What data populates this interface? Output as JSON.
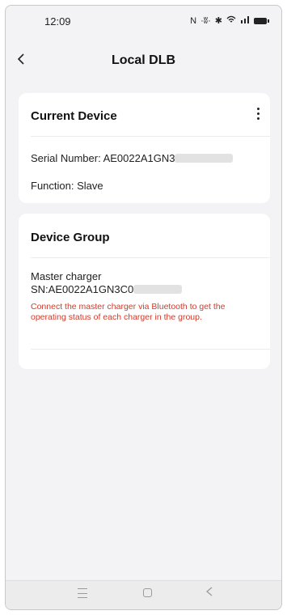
{
  "status": {
    "time": "12:09",
    "icons": [
      "nfc-icon",
      "vibrate-icon",
      "bluetooth-icon",
      "wifi-icon",
      "signal-icon",
      "battery-icon"
    ]
  },
  "header": {
    "back_icon": "chevron-left-icon",
    "title": "Local DLB"
  },
  "current_device": {
    "title": "Current Device",
    "menu_icon": "more-vertical-icon",
    "serial_prefix": "Serial Number: AE0022A1GN3",
    "function": "Function: Slave"
  },
  "device_group": {
    "title": "Device Group",
    "master_label": "Master charger",
    "master_sn_prefix": "SN:AE0022A1GN3C0",
    "warning": "Connect the master charger via Bluetooth to get the operating status of each charger in the group."
  },
  "colors": {
    "background": "#f3f3f5",
    "card": "#ffffff",
    "warning": "#d23a2a"
  },
  "navbar": {
    "icons": [
      "menu-icon",
      "home-icon",
      "back-icon"
    ]
  }
}
